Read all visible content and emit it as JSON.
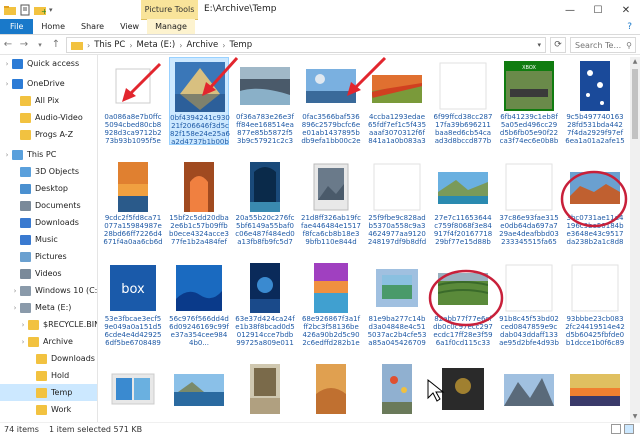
{
  "window": {
    "picture_tools": "Picture Tools",
    "path_title": "E:\\Archive\\Temp",
    "min": "—",
    "max": "☐",
    "close": "✕"
  },
  "ribbon": {
    "tabs": [
      "File",
      "Home",
      "Share",
      "View",
      "Manage"
    ],
    "help": "?"
  },
  "address": {
    "crumbs": [
      "This PC",
      "Meta (E:)",
      "Archive",
      "Temp"
    ],
    "search_placeholder": "Search Te..."
  },
  "nav": [
    {
      "label": "Quick access",
      "indent": 0,
      "color": "#2b7bd6"
    },
    {
      "label": "OneDrive",
      "indent": 0,
      "color": "#2b7bd6"
    },
    {
      "label": "All Pix",
      "indent": 1,
      "color": "#f2c240"
    },
    {
      "label": "Audio-Video",
      "indent": 1,
      "color": "#f2c240"
    },
    {
      "label": "Progs A-Z",
      "indent": 1,
      "color": "#f2c240"
    },
    {
      "label": "This PC",
      "indent": 0,
      "color": "#5aa0dc"
    },
    {
      "label": "3D Objects",
      "indent": 1,
      "color": "#5aa0dc"
    },
    {
      "label": "Desktop",
      "indent": 1,
      "color": "#4a90d0"
    },
    {
      "label": "Documents",
      "indent": 1,
      "color": "#7a8a9a"
    },
    {
      "label": "Downloads",
      "indent": 1,
      "color": "#3a7ad0"
    },
    {
      "label": "Music",
      "indent": 1,
      "color": "#3a7ad0"
    },
    {
      "label": "Pictures",
      "indent": 1,
      "color": "#6aa0d0"
    },
    {
      "label": "Videos",
      "indent": 1,
      "color": "#7a8a9a"
    },
    {
      "label": "Windows 10 (C:",
      "indent": 1,
      "color": "#8a9aaa"
    },
    {
      "label": "Meta (E:)",
      "indent": 1,
      "color": "#8a9aaa"
    },
    {
      "label": "$RECYCLE.BIN",
      "indent": 2,
      "color": "#f2c240"
    },
    {
      "label": "Archive",
      "indent": 2,
      "color": "#f2c240"
    },
    {
      "label": "Downloads",
      "indent": 3,
      "color": "#f2c240"
    },
    {
      "label": "Hold",
      "indent": 3,
      "color": "#f2c240"
    },
    {
      "label": "Temp",
      "indent": 3,
      "color": "#f2c240",
      "selected": true
    },
    {
      "label": "Work",
      "indent": 3,
      "color": "#f2c240"
    },
    {
      "label": "zContests",
      "indent": 3,
      "color": "#f2c240"
    },
    {
      "label": "Data",
      "indent": 2,
      "color": "#f2c240"
    }
  ],
  "tiles": [
    {
      "label": "0a086a8e7b0ffc5094cbed80cb8928d3ca9712b273b93b1095f5ec...",
      "thumb": "white"
    },
    {
      "label": "0bf4394241c93021f206646f3d5c82f158e24e25a6a2d4737b1b00be...",
      "thumb": "mountain",
      "selected": true
    },
    {
      "label": "0f36a783e26e3fff84ee168514ea877e85b5872f53b9c57921c2c33ba2...",
      "thumb": "river"
    },
    {
      "label": "0fac3566baf536896c2579bcfc6ee01ab1437895bdb9efa1bb00c2e45d...",
      "thumb": "landscape"
    },
    {
      "label": "4ccba1293edae65fdf7ef1c5f435aaaf3070312f6f841a1a0b083a31f9ed...",
      "thumb": "grid"
    },
    {
      "label": "6f99ffcd38cc28717fa39b696211baa8ed6cb54caad3d8bccd877ba8be0...",
      "thumb": "blank"
    },
    {
      "label": "6fb41239c1eb8f5a05ed496cc29d5b6fb05e90f22ca3f74ec6e0b8b9011b...",
      "thumb": "minecraft"
    },
    {
      "label": "9c5b49774016328fd531bda4427f4da2929f97ef6ea1a01a2afe15f9fa27...",
      "thumb": "blueflowers"
    },
    {
      "label": "9cdc2f5fd8ca71077a15984987e28bd66ff7226d4671f4a0aa6cb6d1eb...",
      "thumb": "beach"
    },
    {
      "label": "15bf2c5dd20dba2e6b1c57b09ffbb0ece4324acce377fe1b2a484fefe...",
      "thumb": "arch"
    },
    {
      "label": "20a55b20c276fc5bf6149a55baf0c06e487f484ed0a13fb8fb9fc5d7e...",
      "thumb": "cave"
    },
    {
      "label": "21d8ff326ab19fcfae446484e1517f8fca6cb8b18e39bfb110e844d9...",
      "thumb": "frame"
    },
    {
      "label": "25f9fbe9c828adb5370a558c9a34624977aa9120248197df9b8dfd59...",
      "thumb": "blank"
    },
    {
      "label": "27e7c11653644c759f8068f3e84917f4f2016771829bf77e15d88b22...",
      "thumb": "coast"
    },
    {
      "label": "37c86e93fae315e0db64da697a729ae4deafbbd03233345515fa659c...",
      "thumb": "blank"
    },
    {
      "label": "3bc0731ae11d4196c9be50184be3648e43c9517da238b2a1c8d84abc65e1...",
      "thumb": "rocks"
    },
    {
      "label": "53e3fbcae3ecf59e049a0a151d56cde4e4d429256df5be6708489d94d0...",
      "thumb": "box"
    },
    {
      "label": "56c976f566dd4d6d09246169c99fe37a354cee9844b0...",
      "thumb": "bluewave"
    },
    {
      "label": "63e37d424ca24fe1b38f8bcad0d5012914cce7bdb99725a809e01166...",
      "thumb": "deepsea"
    },
    {
      "label": "68e926867f3a1fff2bc3f58136be426a90b2d5c902c6edffd282b1e9a0...",
      "thumb": "colorful"
    },
    {
      "label": "81e9ba277c14bd3a04848e4c515037ac2b4cfe53a85a0454267095449d81e6...",
      "thumb": "glass"
    },
    {
      "label": "82abb77f77e6cfdb0c0c97ecc297ecdc17ff28e3f596a1f0cd115c330...",
      "thumb": "terraces"
    },
    {
      "label": "91b8c45f53bd02ced0847859e9cdab043ddaff133ae95d2bfe4d93bb...",
      "thumb": "blank"
    },
    {
      "label": "93bbbe23cb0832fc24419514e42d5b60425fbfde0b1dcce1b0f6c89a58e5e...",
      "thumb": "blank"
    },
    {
      "label": "",
      "thumb": "gallery"
    },
    {
      "label": "",
      "thumb": "sealandscape"
    },
    {
      "label": "",
      "thumb": "portrait"
    },
    {
      "label": "",
      "thumb": "dunes"
    },
    {
      "label": "",
      "thumb": "balloons"
    },
    {
      "label": "",
      "thumb": "dark"
    },
    {
      "label": "",
      "thumb": "peaks"
    },
    {
      "label": "",
      "thumb": "sunset"
    }
  ],
  "status": {
    "count": "74 items",
    "selection": "1 item selected  571 KB"
  }
}
